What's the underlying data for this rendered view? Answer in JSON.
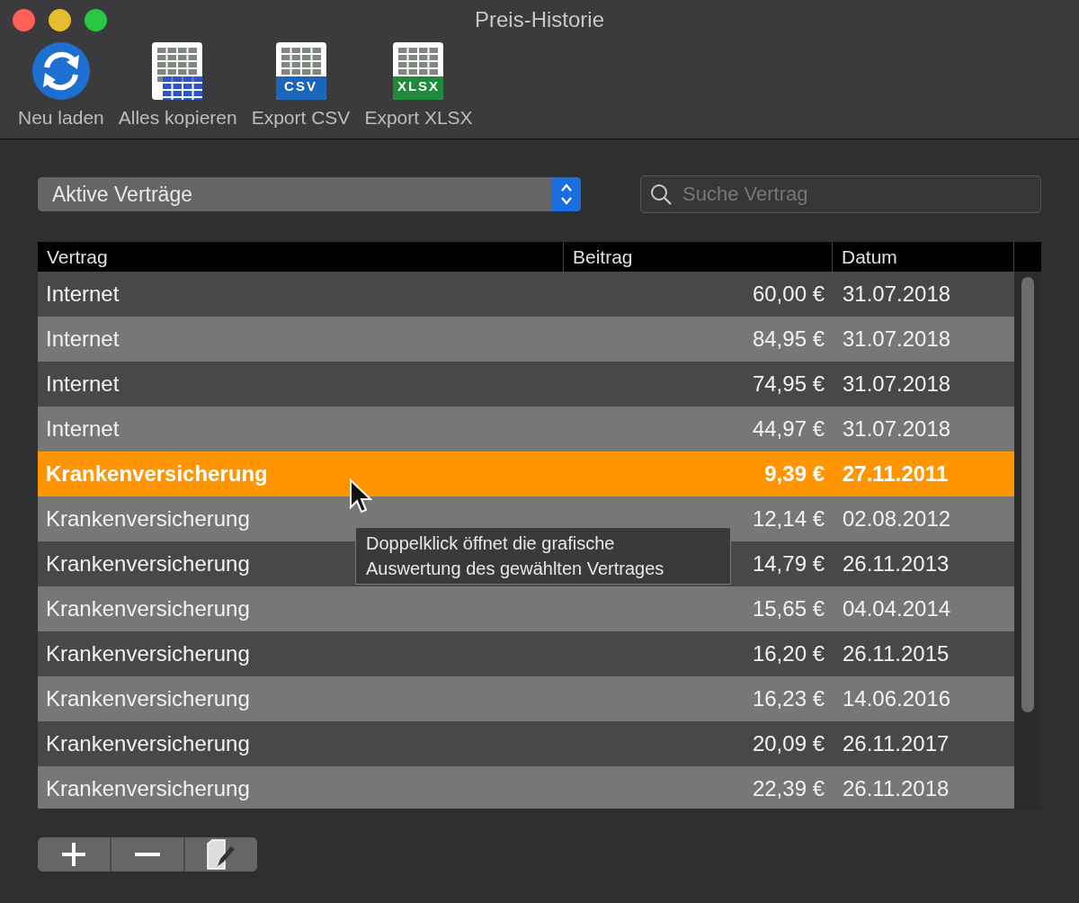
{
  "window": {
    "title": "Preis-Historie"
  },
  "toolbar": [
    {
      "kind": "reload",
      "label": "Neu laden"
    },
    {
      "kind": "copy",
      "label": "Alles kopieren"
    },
    {
      "kind": "csv",
      "label": "Export CSV",
      "badge": "CSV"
    },
    {
      "kind": "xlsx",
      "label": "Export XLSX",
      "badge": "XLSX"
    }
  ],
  "filter": {
    "value": "Aktive Verträge"
  },
  "search": {
    "placeholder": "Suche Vertrag"
  },
  "table": {
    "columns": [
      "Vertrag",
      "Beitrag",
      "Datum"
    ],
    "rows": [
      {
        "vertrag": "Internet",
        "beitrag": "60,00 €",
        "datum": "31.07.2018",
        "selected": false
      },
      {
        "vertrag": "Internet",
        "beitrag": "84,95 €",
        "datum": "31.07.2018",
        "selected": false
      },
      {
        "vertrag": "Internet",
        "beitrag": "74,95 €",
        "datum": "31.07.2018",
        "selected": false
      },
      {
        "vertrag": "Internet",
        "beitrag": "44,97 €",
        "datum": "31.07.2018",
        "selected": false
      },
      {
        "vertrag": "Krankenversicherung",
        "beitrag": "9,39 €",
        "datum": "27.11.2011",
        "selected": true
      },
      {
        "vertrag": "Krankenversicherung",
        "beitrag": "12,14 €",
        "datum": "02.08.2012",
        "selected": false
      },
      {
        "vertrag": "Krankenversicherung",
        "beitrag": "14,79 €",
        "datum": "26.11.2013",
        "selected": false
      },
      {
        "vertrag": "Krankenversicherung",
        "beitrag": "15,65 €",
        "datum": "04.04.2014",
        "selected": false
      },
      {
        "vertrag": "Krankenversicherung",
        "beitrag": "16,20 €",
        "datum": "26.11.2015",
        "selected": false
      },
      {
        "vertrag": "Krankenversicherung",
        "beitrag": "16,23 €",
        "datum": "14.06.2016",
        "selected": false
      },
      {
        "vertrag": "Krankenversicherung",
        "beitrag": "20,09 €",
        "datum": "26.11.2017",
        "selected": false
      },
      {
        "vertrag": "Krankenversicherung",
        "beitrag": "22,39 €",
        "datum": "26.11.2018",
        "selected": false
      }
    ]
  },
  "tooltip": {
    "text": "Doppelklick öffnet die grafische Auswertung des gewählten Vertrages"
  },
  "bottom_buttons": [
    {
      "kind": "add"
    },
    {
      "kind": "remove"
    },
    {
      "kind": "edit"
    }
  ]
}
